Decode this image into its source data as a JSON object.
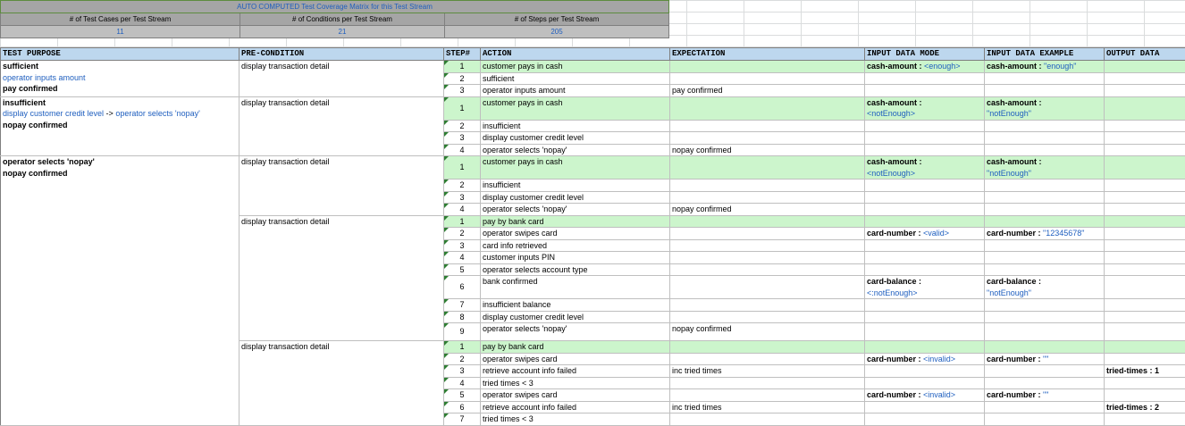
{
  "summary": {
    "title": "AUTO COMPUTED Test Coverage Matrix for this Test Stream",
    "headers": [
      "# of Test Cases per Test Stream",
      "# of Conditions per Test Stream",
      "# of Steps per Test Stream"
    ],
    "values": [
      "11",
      "21",
      "205"
    ]
  },
  "columns": [
    "TEST PURPOSE",
    "PRE-CONDITION",
    "STEP#",
    "ACTION",
    "EXPECTATION",
    "INPUT DATA MODE",
    "INPUT DATA EXAMPLE",
    "OUTPUT DATA"
  ],
  "purposes": {
    "p1": {
      "l1": "sufficient",
      "l2": "operator inputs amount",
      "l3": "pay confirmed"
    },
    "p2": {
      "l1": "insufficient",
      "l2a": "display customer credit level",
      "l2b": " -> ",
      "l2c": "operator selects 'nopay'",
      "l3": "nopay confirmed"
    },
    "p3": {
      "l1": "operator selects 'nopay'",
      "l2": "nopay confirmed"
    }
  },
  "precondition": "display transaction detail",
  "rows": [
    {
      "step": "1",
      "action": "customer pays in cash",
      "exp": "",
      "mode_k": "cash-amount : ",
      "mode_v": "<enough>",
      "ex_k": "cash-amount : ",
      "ex_v": "\"enough\"",
      "out": ""
    },
    {
      "step": "2",
      "action": "sufficient",
      "exp": "",
      "mode_k": "",
      "mode_v": "",
      "ex_k": "",
      "ex_v": "",
      "out": ""
    },
    {
      "step": "3",
      "action": "operator inputs amount",
      "exp": "pay confirmed",
      "mode_k": "",
      "mode_v": "",
      "ex_k": "",
      "ex_v": "",
      "out": ""
    },
    {
      "step": "1",
      "action": "customer pays in cash",
      "exp": "",
      "mode_k": "cash-amount :",
      "mode_v": "<notEnough>",
      "ex_k": "cash-amount :",
      "ex_v": "\"notEnough\"",
      "out": ""
    },
    {
      "step": "2",
      "action": "insufficient",
      "exp": "",
      "mode_k": "",
      "mode_v": "",
      "ex_k": "",
      "ex_v": "",
      "out": ""
    },
    {
      "step": "3",
      "action": "display customer credit level",
      "exp": "",
      "mode_k": "",
      "mode_v": "",
      "ex_k": "",
      "ex_v": "",
      "out": ""
    },
    {
      "step": "4",
      "action": "operator selects 'nopay'",
      "exp": "nopay confirmed",
      "mode_k": "",
      "mode_v": "",
      "ex_k": "",
      "ex_v": "",
      "out": ""
    },
    {
      "step": "1",
      "action": "customer pays in cash",
      "exp": "",
      "mode_k": "cash-amount :",
      "mode_v": "<notEnough>",
      "ex_k": "cash-amount :",
      "ex_v": "\"notEnough\"",
      "out": ""
    },
    {
      "step": "2",
      "action": "insufficient",
      "exp": "",
      "mode_k": "",
      "mode_v": "",
      "ex_k": "",
      "ex_v": "",
      "out": ""
    },
    {
      "step": "3",
      "action": "display customer credit level",
      "exp": "",
      "mode_k": "",
      "mode_v": "",
      "ex_k": "",
      "ex_v": "",
      "out": ""
    },
    {
      "step": "4",
      "action": "operator selects 'nopay'",
      "exp": "nopay confirmed",
      "mode_k": "",
      "mode_v": "",
      "ex_k": "",
      "ex_v": "",
      "out": ""
    },
    {
      "step": "1",
      "action": "pay by bank card",
      "exp": "",
      "mode_k": "",
      "mode_v": "",
      "ex_k": "",
      "ex_v": "",
      "out": ""
    },
    {
      "step": "2",
      "action": "operator swipes card",
      "exp": "",
      "mode_k": "card-number : ",
      "mode_v": "<valid>",
      "ex_k": "card-number : ",
      "ex_v": "\"12345678\"",
      "out": ""
    },
    {
      "step": "3",
      "action": "card info retrieved",
      "exp": "",
      "mode_k": "",
      "mode_v": "",
      "ex_k": "",
      "ex_v": "",
      "out": ""
    },
    {
      "step": "4",
      "action": "customer inputs PIN",
      "exp": "",
      "mode_k": "",
      "mode_v": "",
      "ex_k": "",
      "ex_v": "",
      "out": ""
    },
    {
      "step": "5",
      "action": "operator selects account type",
      "exp": "",
      "mode_k": "",
      "mode_v": "",
      "ex_k": "",
      "ex_v": "",
      "out": ""
    },
    {
      "step": "6",
      "action": "bank confirmed",
      "exp": "",
      "mode_k": "card-balance :",
      "mode_v": "<:notEnough>",
      "ex_k": "card-balance :",
      "ex_v": "\"notEnough\"",
      "out": ""
    },
    {
      "step": "7",
      "action": "insufficient balance",
      "exp": "",
      "mode_k": "",
      "mode_v": "",
      "ex_k": "",
      "ex_v": "",
      "out": ""
    },
    {
      "step": "8",
      "action": "display customer credit level",
      "exp": "",
      "mode_k": "",
      "mode_v": "",
      "ex_k": "",
      "ex_v": "",
      "out": ""
    },
    {
      "step": "9",
      "action": "operator selects 'nopay'",
      "exp": "nopay confirmed",
      "mode_k": "",
      "mode_v": "",
      "ex_k": "",
      "ex_v": "",
      "out": ""
    },
    {
      "step": "1",
      "action": "pay by bank card",
      "exp": "",
      "mode_k": "",
      "mode_v": "",
      "ex_k": "",
      "ex_v": "",
      "out": ""
    },
    {
      "step": "2",
      "action": "operator swipes card",
      "exp": "",
      "mode_k": "card-number : ",
      "mode_v": "<invalid>",
      "ex_k": "card-number : ",
      "ex_v": "\"\"",
      "out": ""
    },
    {
      "step": "3",
      "action": "retrieve account info failed",
      "exp": "inc tried times",
      "mode_k": "",
      "mode_v": "",
      "ex_k": "",
      "ex_v": "",
      "out": "tried-times : 1"
    },
    {
      "step": "4",
      "action": "tried times < 3",
      "exp": "",
      "mode_k": "",
      "mode_v": "",
      "ex_k": "",
      "ex_v": "",
      "out": ""
    },
    {
      "step": "5",
      "action": "operator swipes card",
      "exp": "",
      "mode_k": "card-number : ",
      "mode_v": "<invalid>",
      "ex_k": "card-number : ",
      "ex_v": "\"\"",
      "out": ""
    },
    {
      "step": "6",
      "action": "retrieve account info failed",
      "exp": "inc tried times",
      "mode_k": "",
      "mode_v": "",
      "ex_k": "",
      "ex_v": "",
      "out": "tried-times : 2"
    },
    {
      "step": "7",
      "action": "tried times < 3",
      "exp": "",
      "mode_k": "",
      "mode_v": "",
      "ex_k": "",
      "ex_v": "",
      "out": ""
    }
  ]
}
